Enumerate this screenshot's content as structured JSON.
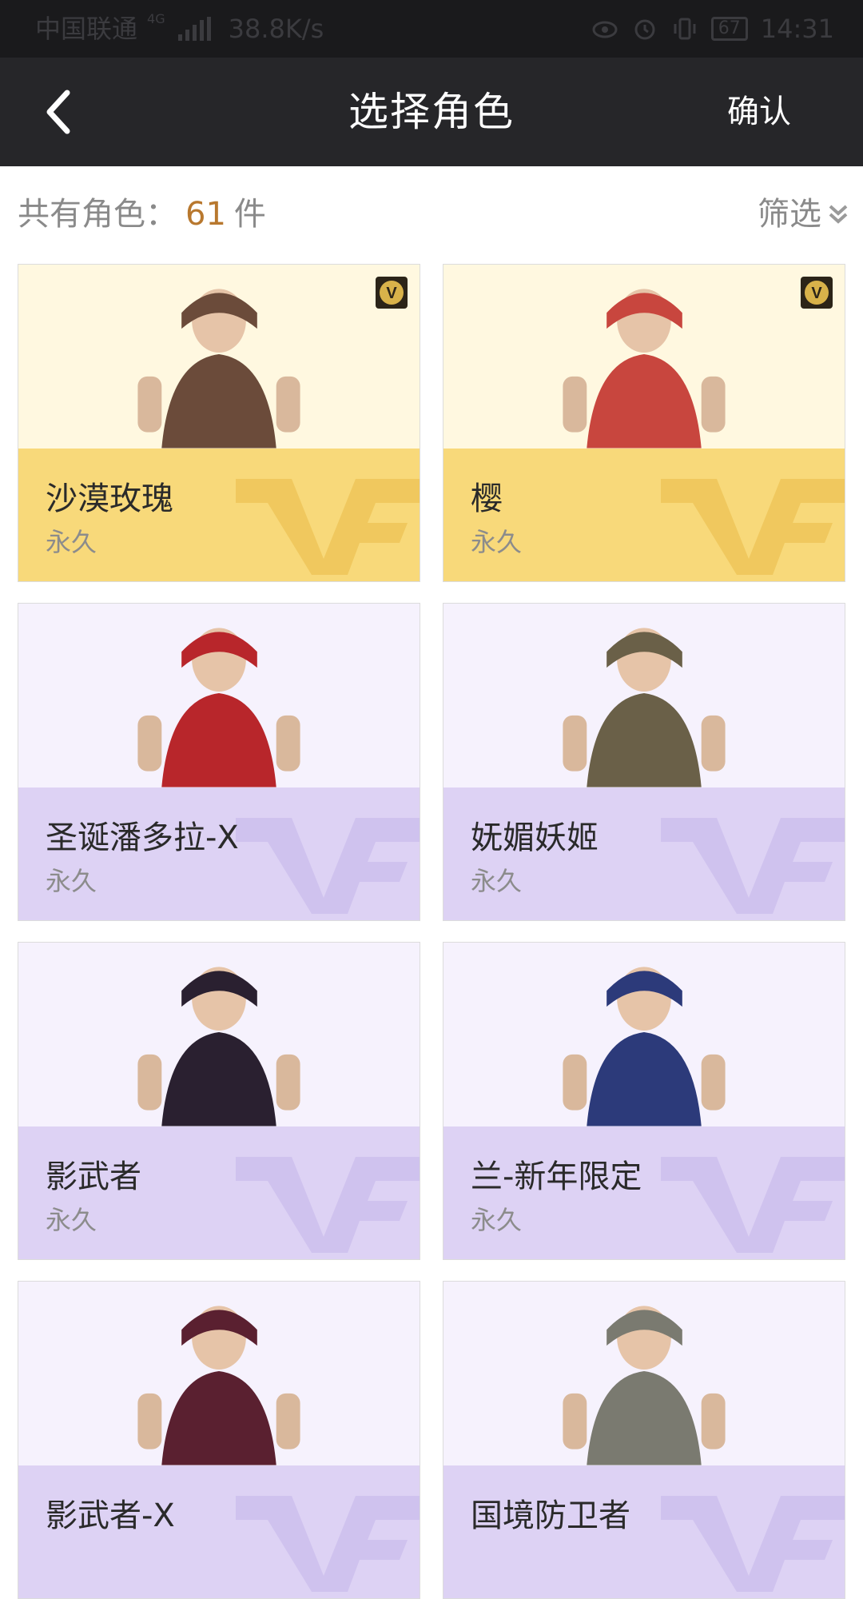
{
  "status_bar": {
    "carrier": "中国联通",
    "network": "4G",
    "speed": "38.8K/s",
    "battery": "67",
    "time": "14:31"
  },
  "header": {
    "title": "选择角色",
    "confirm_label": "确认",
    "back_icon": "chevron-left-icon"
  },
  "summary": {
    "prefix": "共有角色：",
    "count": "61",
    "suffix": "件",
    "filter_label": "筛选"
  },
  "colors": {
    "header_bg": "#262629",
    "accent_count": "#b8782e",
    "gold_card_bottom": "#f8d97a",
    "purple_card_bottom": "#ddd2f4"
  },
  "cards": [
    {
      "name": "沙漠玫瑰",
      "duration": "永久",
      "theme": "gold",
      "vip": true
    },
    {
      "name": "樱",
      "duration": "永久",
      "theme": "gold",
      "vip": true
    },
    {
      "name": "圣诞潘多拉-X",
      "duration": "永久",
      "theme": "purple",
      "vip": false
    },
    {
      "name": "妩媚妖姬",
      "duration": "永久",
      "theme": "purple",
      "vip": false
    },
    {
      "name": "影武者",
      "duration": "永久",
      "theme": "purple",
      "vip": false
    },
    {
      "name": "兰-新年限定",
      "duration": "永久",
      "theme": "purple",
      "vip": false
    },
    {
      "name": "影武者-X",
      "duration": "",
      "theme": "purple",
      "vip": false
    },
    {
      "name": "国境防卫者",
      "duration": "",
      "theme": "purple",
      "vip": false
    }
  ]
}
